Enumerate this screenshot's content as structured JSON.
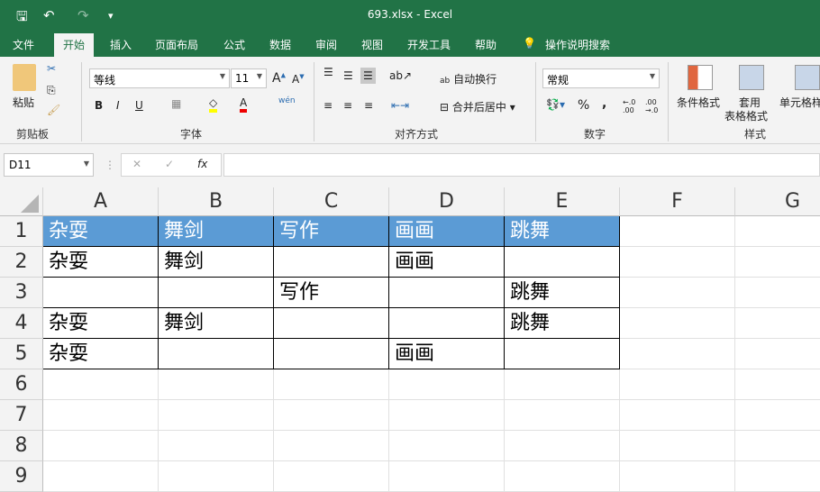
{
  "title": "693.xlsx  -  Excel",
  "quick_access": {
    "save": "🖫",
    "undo": "↶",
    "redo": "↷",
    "customize": "▾"
  },
  "tabs": [
    "文件",
    "开始",
    "插入",
    "页面布局",
    "公式",
    "数据",
    "审阅",
    "视图",
    "开发工具",
    "帮助",
    "操作说明搜索"
  ],
  "ribbon": {
    "clipboard": {
      "paste": "粘贴",
      "group": "剪贴板"
    },
    "font": {
      "name": "等线",
      "size": "11",
      "bold": "B",
      "italic": "I",
      "underline": "U",
      "phonetic": "wén",
      "group": "字体"
    },
    "alignment": {
      "wrap": "自动换行",
      "merge": "合并后居中",
      "group": "对齐方式"
    },
    "number": {
      "format": "常规",
      "percent": "%",
      "comma": ",",
      "inc": "←.0 .00",
      "dec": ".00 →.0",
      "group": "数字"
    },
    "styles": {
      "conditional": "条件格式",
      "table1": "套用",
      "table2": "表格格式",
      "cell": "单元格样式",
      "group": "样式"
    }
  },
  "formula_bar": {
    "name_box": "D11",
    "fx": "fx",
    "cancel": "✕",
    "enter": "✓",
    "value": ""
  },
  "columns": [
    "A",
    "B",
    "C",
    "D",
    "E",
    "F",
    "G"
  ],
  "rows": [
    "1",
    "2",
    "3",
    "4",
    "5",
    "6",
    "7",
    "8",
    "9"
  ],
  "cells": [
    [
      "杂耍",
      "舞剑",
      "写作",
      "画画",
      "跳舞"
    ],
    [
      "杂耍",
      "舞剑",
      "",
      "画画",
      ""
    ],
    [
      "",
      "",
      "写作",
      "",
      "跳舞"
    ],
    [
      "杂耍",
      "舞剑",
      "",
      "",
      "跳舞"
    ],
    [
      "杂耍",
      "",
      "",
      "画画",
      ""
    ]
  ],
  "colors": {
    "brand": "#217346",
    "header_fill": "#5b9bd5"
  }
}
